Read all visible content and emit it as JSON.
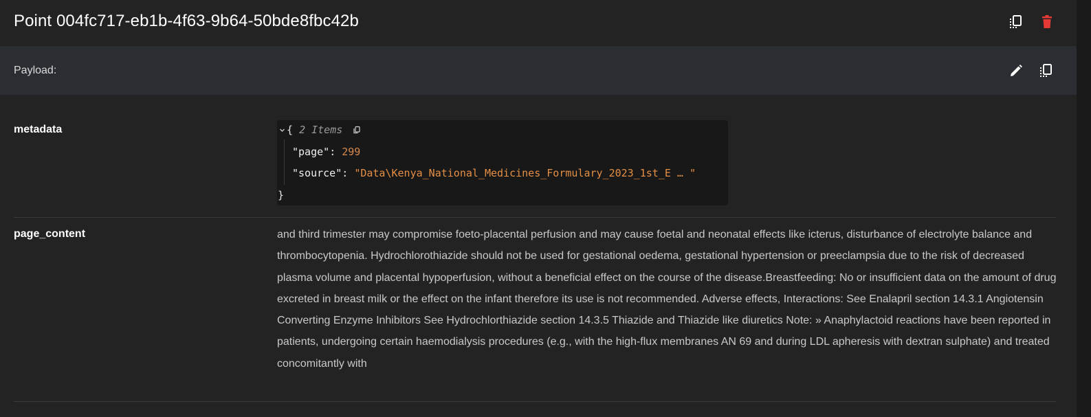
{
  "header": {
    "title": "Point 004fc717-eb1b-4f63-9b64-50bde8fbc42b",
    "copy_icon": "copy-icon",
    "delete_icon": "trash-icon"
  },
  "payload": {
    "label": "Payload:",
    "edit_icon": "pencil-icon",
    "copy_icon": "copy-icon"
  },
  "fields": {
    "metadata": {
      "key": "metadata",
      "open_brace": "{",
      "close_brace": "}",
      "count_label": "2 Items",
      "items": [
        {
          "key": "\"page\"",
          "colon": ":",
          "value": "299"
        },
        {
          "key": "\"source\"",
          "colon": ":",
          "value": "\"Data\\Kenya_National_Medicines_Formulary_2023_1st_E … \""
        }
      ]
    },
    "page_content": {
      "key": "page_content",
      "value": "and third trimester may compromise foeto-placental perfusion and may cause foetal and neonatal effects like icterus, disturbance of electrolyte balance and thrombocytopenia. Hydrochlorothiazide should not be used for gestational oedema, gestational hypertension or preeclampsia due to the risk of decreased plasma volume and placental hypoperfusion, without a beneficial effect on the course of the disease.Breastfeeding: No or insufficient data on the amount of drug excreted in breast milk or the effect on the infant therefore its use is not recommended. Adverse effects, Interactions: See Enalapril section 14.3.1 Angiotensin Converting Enzyme Inhibitors See Hydrochlorthiazide section 14.3.5 Thiazide and Thiazide like diuretics Note: » Anaphylactoid reactions have been reported in patients, undergoing certain haemodialysis procedures (e.g., with the high-flux membranes AN 69 and during LDL apheresis with dextran sulphate) and treated concomitantly with"
    }
  },
  "colors": {
    "background": "#232323",
    "payload_bar": "#2a2d31",
    "delete_red": "#e53935",
    "json_string": "#e58f44",
    "json_number": "#d88a4e"
  }
}
